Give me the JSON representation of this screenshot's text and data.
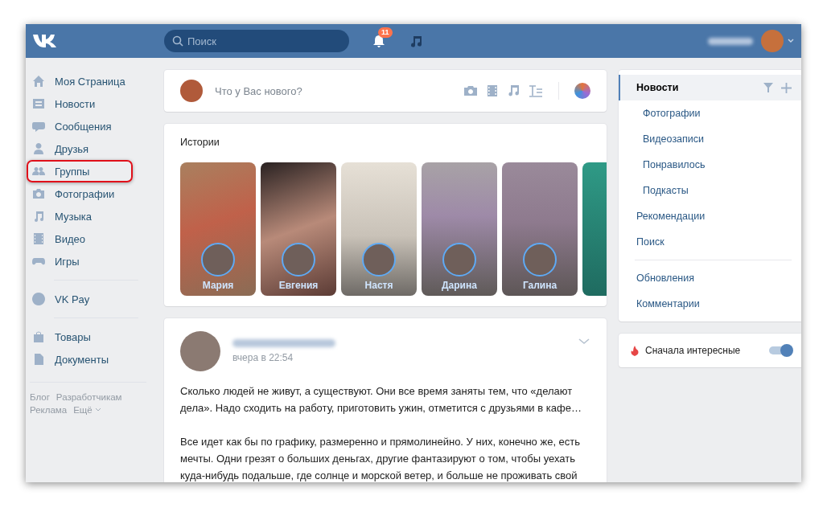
{
  "header": {
    "search": {
      "placeholder": "Поиск"
    },
    "notifications": {
      "count": "11"
    }
  },
  "sidebar": {
    "sections": [
      [
        {
          "label": "Моя Страница",
          "kind": "home",
          "highlighted": false
        },
        {
          "label": "Новости",
          "kind": "news",
          "highlighted": false
        },
        {
          "label": "Сообщения",
          "kind": "chat",
          "highlighted": false
        },
        {
          "label": "Друзья",
          "kind": "user",
          "highlighted": false
        },
        {
          "label": "Группы",
          "kind": "users",
          "highlighted": true
        },
        {
          "label": "Фотографии",
          "kind": "camera",
          "highlighted": false
        },
        {
          "label": "Музыка",
          "kind": "note",
          "highlighted": false
        },
        {
          "label": "Видео",
          "kind": "film",
          "highlighted": false
        },
        {
          "label": "Игры",
          "kind": "gamepad",
          "highlighted": false
        }
      ],
      [
        {
          "label": "VK Pay",
          "kind": "ruble",
          "highlighted": false
        }
      ],
      [
        {
          "label": "Товары",
          "kind": "bag",
          "highlighted": false
        },
        {
          "label": "Документы",
          "kind": "doc",
          "highlighted": false
        }
      ]
    ],
    "footer": [
      "Блог",
      "Разработчикам",
      "Реклама",
      "Ещё"
    ]
  },
  "composer": {
    "placeholder": "Что у Вас нового?"
  },
  "stories": {
    "title": "Истории",
    "items": [
      "Мария",
      "Евгения",
      "Настя",
      "Дарина",
      "Галина"
    ]
  },
  "post": {
    "time": "вчера в 22:54",
    "paragraphs": [
      "Сколько людей не живут, а существуют. Они все время заняты тем, что «делают дела». Надо сходить на работу, приготовить ужин, отметится с друзьями в кафе…",
      "Все идет как бы по графику, размеренно и прямолинейно. У них, конечно же, есть мечты. Одни грезят о больших деньгах, другие фантазируют о том, чтобы уехать куда-нибудь подальше, где солнце и морской ветер, и больше не проживать свой"
    ]
  },
  "news_menu": {
    "sections": [
      [
        {
          "label": "Новости",
          "selected": true,
          "children": [
            {
              "label": "Фотографии",
              "selected": false
            },
            {
              "label": "Видеозаписи",
              "selected": false
            },
            {
              "label": "Понравилось",
              "selected": false
            },
            {
              "label": "Подкасты",
              "selected": false
            }
          ]
        },
        {
          "label": "Рекомендации",
          "selected": false
        },
        {
          "label": "Поиск",
          "selected": false
        }
      ],
      [
        {
          "label": "Обновления",
          "selected": false
        },
        {
          "label": "Комментарии",
          "selected": false
        }
      ]
    ]
  },
  "interesting_first": {
    "label": "Сначала интересные",
    "on": true
  }
}
